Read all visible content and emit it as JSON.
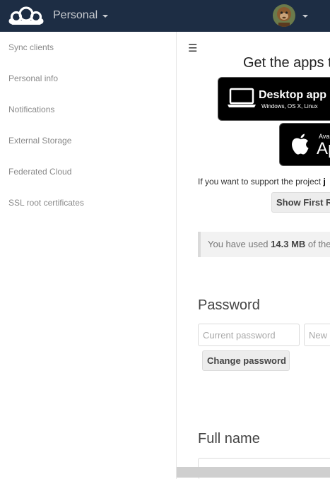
{
  "header": {
    "app_name": "Personal",
    "icons": {
      "logo": "cloud-logo-icon",
      "app_menu": "caret-down-icon",
      "user": "avatar"
    },
    "colors": {
      "background": "#1d2d44",
      "text": "#c9ccd1"
    }
  },
  "sidebar": {
    "items": [
      {
        "label": "Sync clients"
      },
      {
        "label": "Personal info"
      },
      {
        "label": "Notifications"
      },
      {
        "label": "External Storage"
      },
      {
        "label": "Federated Cloud"
      },
      {
        "label": "SSL root certificates"
      }
    ]
  },
  "content": {
    "menu_icon": "hamburger-icon",
    "apps_title": "Get the apps t",
    "desktop_badge": {
      "title": "Desktop app",
      "subtitle": "Windows, OS X, Linux",
      "icon": "laptop-icon"
    },
    "apple_badge": {
      "small": "Ava",
      "big": "Ap",
      "icon": "apple-icon"
    },
    "support_text": "If you want to support the project ",
    "support_bold": "j",
    "show_first_run_button": "Show First R",
    "quota": {
      "prefix": "You have used ",
      "used": "14.3 MB",
      "suffix": " of the"
    },
    "password": {
      "title": "Password",
      "current_placeholder": "Current password",
      "new_placeholder": "New p",
      "change_button": "Change password"
    },
    "full_name": {
      "title": "Full name"
    }
  }
}
